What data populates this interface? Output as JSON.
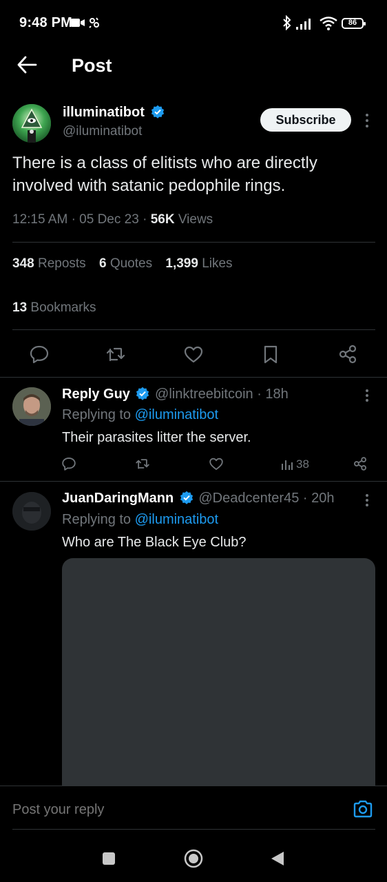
{
  "status_bar": {
    "time": "9:48 PM",
    "battery": "86"
  },
  "header": {
    "title": "Post"
  },
  "tweet": {
    "author_name": "illuminatibot",
    "author_handle": "@iluminatibot",
    "subscribe_label": "Subscribe",
    "text": "There is a class of elitists who are directly involved with satanic pedophile rings.",
    "time": "12:15 AM",
    "date": "05 Dec 23",
    "views_count": "56K",
    "views_label": "Views",
    "reposts_count": "348",
    "reposts_label": "Reposts",
    "quotes_count": "6",
    "quotes_label": "Quotes",
    "likes_count": "1,399",
    "likes_label": "Likes",
    "bookmarks_count": "13",
    "bookmarks_label": "Bookmarks"
  },
  "replies": [
    {
      "name": "Reply Guy",
      "handle": "@linktreebitcoin",
      "age": "18h",
      "replying_prefix": "Replying to",
      "replying_to": "@iluminatibot",
      "text": "Their parasites litter the server.",
      "views": "38"
    },
    {
      "name": "JuanDaringMann",
      "handle": "@Deadcenter45",
      "age": "20h",
      "replying_prefix": "Replying to",
      "replying_to": "@iluminatibot",
      "text": "Who are The Black Eye Club?"
    }
  ],
  "composer": {
    "placeholder": "Post your reply"
  },
  "colors": {
    "accent": "#1d9bf0",
    "background": "#000000",
    "muted": "#71767b",
    "text": "#e7e9ea",
    "divider": "#2f3336"
  },
  "icons": [
    "video-camera-icon",
    "notification-icon",
    "bluetooth-icon",
    "signal-icon",
    "wifi-icon",
    "battery-icon",
    "back-arrow-icon",
    "verified-badge-icon",
    "more-options-icon",
    "reply-icon",
    "repost-icon",
    "like-icon",
    "bookmark-icon",
    "share-icon",
    "views-icon",
    "camera-icon",
    "recents-icon",
    "home-icon",
    "back-icon"
  ]
}
